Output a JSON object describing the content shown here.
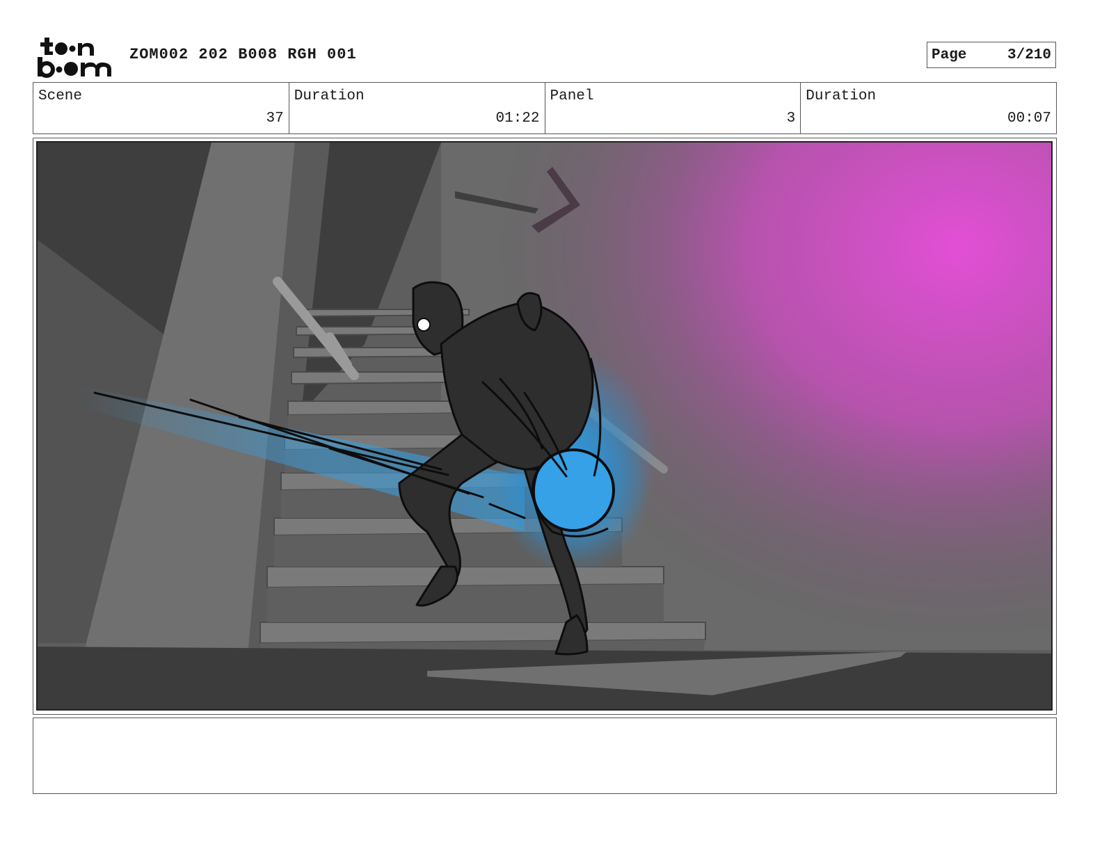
{
  "header": {
    "logo_text": "toon boom",
    "title": "ZOM002 202 B008 RGH 001",
    "page_label": "Page",
    "page_value": "3/210"
  },
  "info": {
    "scene_label": "Scene",
    "scene_value": "37",
    "scene_duration_label": "Duration",
    "scene_duration_value": "01:22",
    "panel_label": "Panel",
    "panel_value": "3",
    "panel_duration_label": "Duration",
    "panel_duration_value": "00:07"
  },
  "notes": {
    "text": ""
  },
  "colors": {
    "glow_blue": "#2fa4ea",
    "magenta": "#e24fd6",
    "scene_gray": "#5a5a5a"
  }
}
